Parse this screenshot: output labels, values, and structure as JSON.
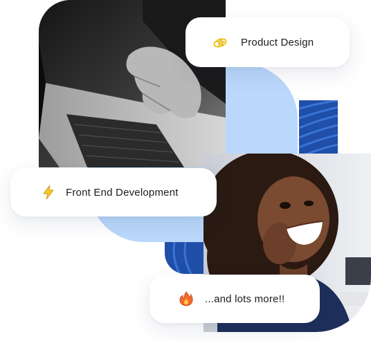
{
  "colors": {
    "accent_light_blue": "#b9d8fb",
    "accent_dark_blue": "#1f4fa8",
    "card_background": "#ffffff",
    "text": "#1b1b1f"
  },
  "images": {
    "laptop_photo": "laptop-typing-photo",
    "portrait_photo": "smiling-woman-photo"
  },
  "cards": {
    "product_design": {
      "icon": "shooting-star-icon",
      "label": "Product Design"
    },
    "front_end": {
      "icon": "lightning-bolt-icon",
      "label": "Front End Development"
    },
    "more": {
      "icon": "fire-icon",
      "label": "...and lots more!!"
    }
  }
}
